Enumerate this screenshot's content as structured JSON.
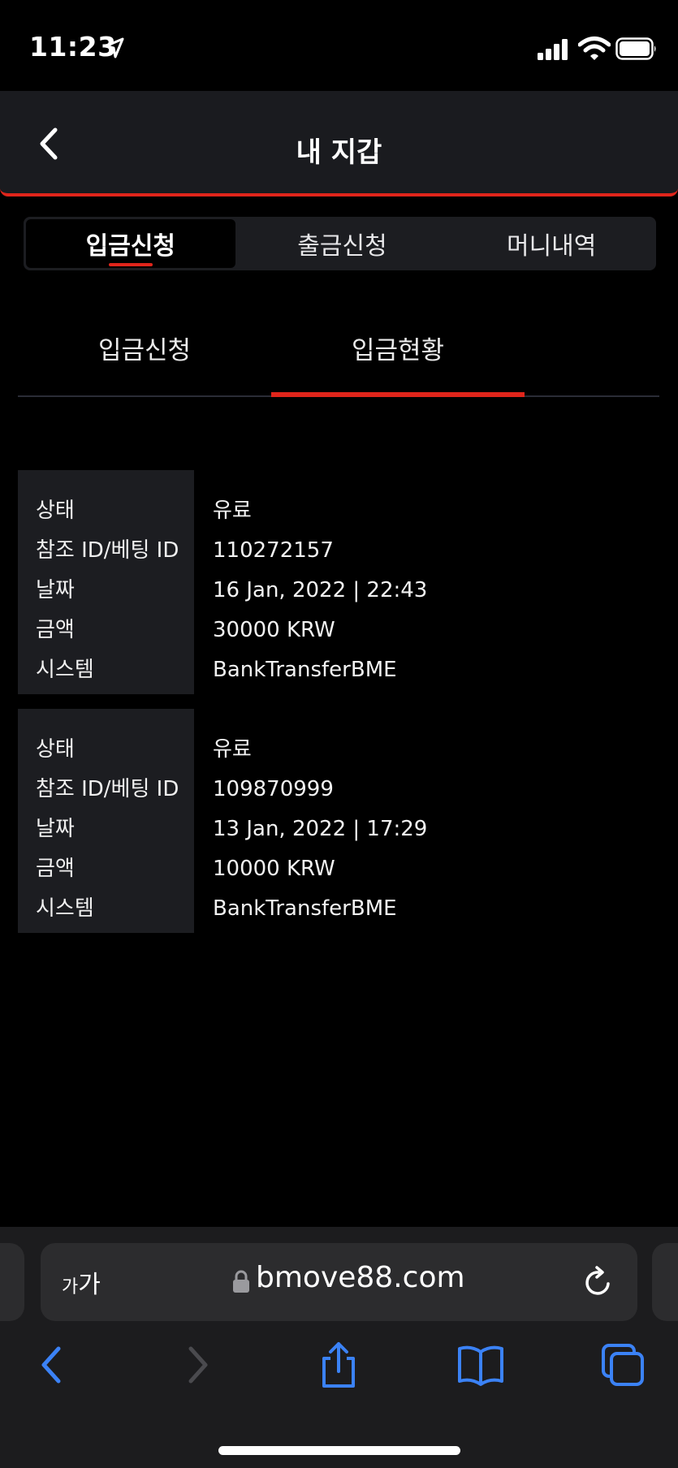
{
  "status_bar": {
    "time": "11:23"
  },
  "header": {
    "title": "내 지갑"
  },
  "main_tabs": [
    {
      "label": "입금신청",
      "active": true
    },
    {
      "label": "출금신청",
      "active": false
    },
    {
      "label": "머니내역",
      "active": false
    }
  ],
  "sub_tabs": [
    {
      "label": "입금신청",
      "active": false
    },
    {
      "label": "입금현황",
      "active": true
    }
  ],
  "records": [
    {
      "labels": [
        "상태",
        "참조 ID/베팅 ID",
        "날짜",
        "금액",
        "시스템"
      ],
      "status": "유료",
      "ref_id": "110272157",
      "date": "16 Jan, 2022 | 22:43",
      "amount": "30000 KRW",
      "system": "BankTransferBME"
    },
    {
      "labels": [
        "상태",
        "참조 ID/베팅 ID",
        "날짜",
        "금액",
        "시스템"
      ],
      "status": "유료",
      "ref_id": "109870999",
      "date": "13 Jan, 2022 | 17:29",
      "amount": "10000 KRW",
      "system": "BankTransferBME"
    }
  ],
  "browser": {
    "text_size_label_small": "가",
    "text_size_label_large": "가",
    "url": "bmove88.com"
  },
  "colors": {
    "accent": "#e0251b",
    "header_bg": "#1a1b1f",
    "label_cell_bg": "#1c1d21",
    "link_blue": "#3b82f6"
  },
  "icons": {
    "location": "location-arrow-icon",
    "signal": "cellular-signal-icon",
    "wifi": "wifi-icon",
    "battery": "battery-icon",
    "back": "chevron-left-icon",
    "lock": "lock-icon",
    "reload": "reload-icon",
    "share": "share-icon",
    "bookmarks": "book-icon",
    "tabs": "tabs-icon"
  }
}
